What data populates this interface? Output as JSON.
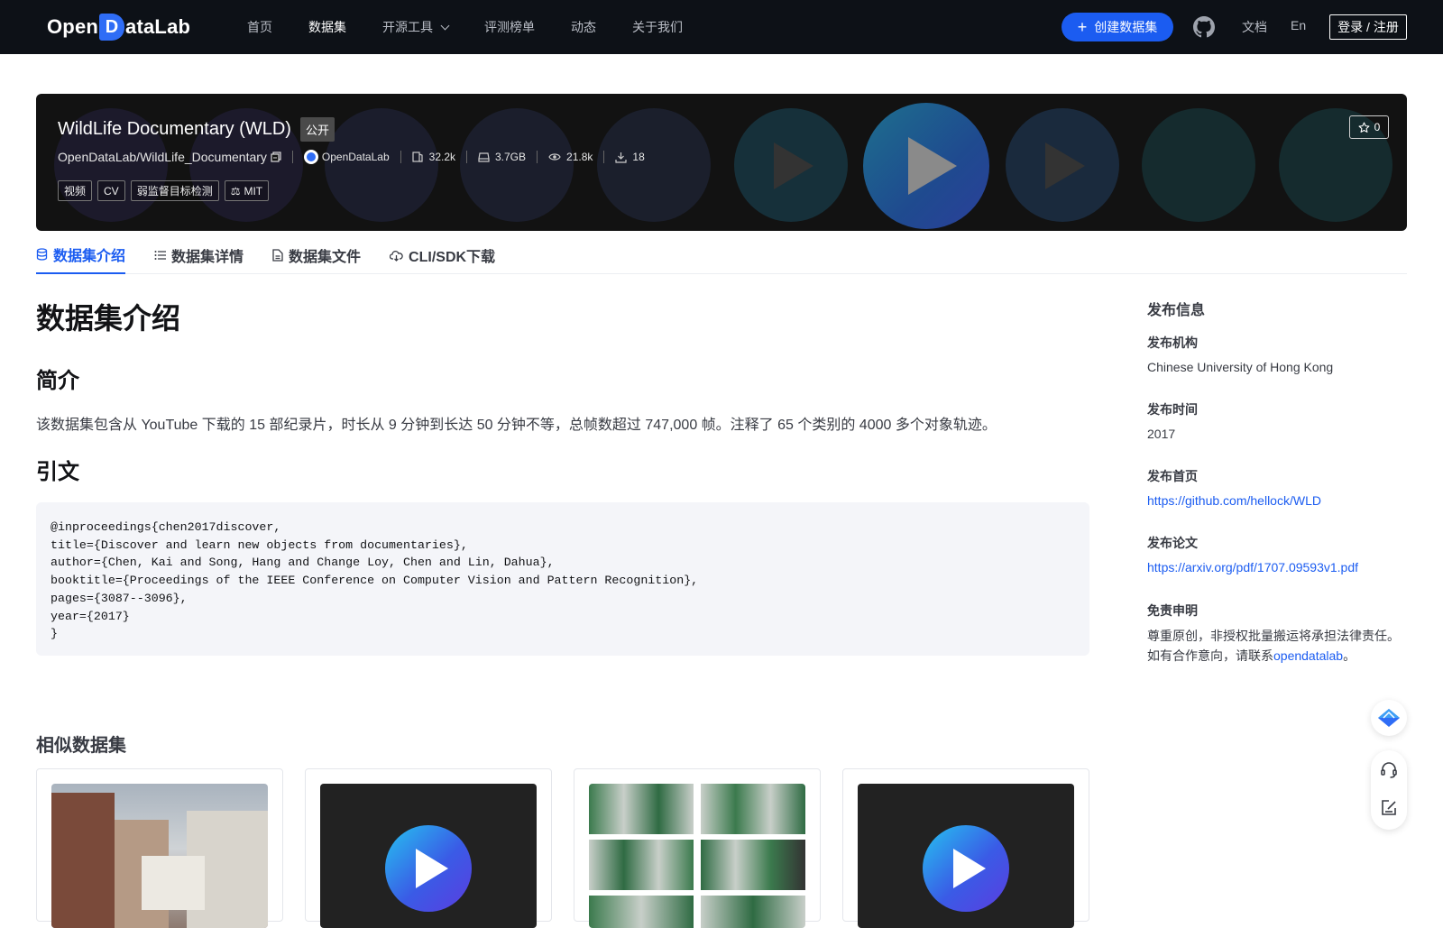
{
  "nav": {
    "logo_left": "Open",
    "logo_d": "D",
    "logo_right": "ataLab",
    "items": [
      {
        "label": "首页"
      },
      {
        "label": "数据集"
      },
      {
        "label": "开源工具"
      },
      {
        "label": "评测榜单"
      },
      {
        "label": "动态"
      },
      {
        "label": "关于我们"
      }
    ],
    "active_item": "数据集",
    "create_button": "创建数据集",
    "docs": "文档",
    "lang": "En",
    "login": "登录 / 注册"
  },
  "banner": {
    "title": "WildLife Documentary (WLD)",
    "visibility": "公开",
    "path": "OpenDataLab/WildLife_Documentary",
    "org": "OpenDataLab",
    "file_count": "32.2k",
    "size": "3.7GB",
    "views": "21.8k",
    "downloads": "18",
    "stars": "0",
    "tags": [
      "视频",
      "CV",
      "弱监督目标检测"
    ],
    "license": "MIT"
  },
  "tabs": [
    {
      "label": "数据集介绍",
      "icon": "database-icon"
    },
    {
      "label": "数据集详情",
      "icon": "list-icon"
    },
    {
      "label": "数据集文件",
      "icon": "file-icon"
    },
    {
      "label": "CLI/SDK下载",
      "icon": "cloud-download-icon"
    }
  ],
  "active_tab": "数据集介绍",
  "content": {
    "title": "数据集介绍",
    "intro_heading": "简介",
    "intro_text": "该数据集包含从 YouTube 下载的 15 部纪录片，时长从 9 分钟到长达 50 分钟不等，总帧数超过 747,000 帧。注释了 65 个类别的 4000 多个对象轨迹。",
    "citation_heading": "引文",
    "citation": "@inproceedings{chen2017discover,\ntitle={Discover and learn new objects from documentaries},\nauthor={Chen, Kai and Song, Hang and Change Loy, Chen and Lin, Dahua},\nbooktitle={Proceedings of the IEEE Conference on Computer Vision and Pattern Recognition},\npages={3087--3096},\nyear={2017}\n}"
  },
  "sidebar": {
    "title": "发布信息",
    "org_label": "发布机构",
    "org_value": "Chinese University of Hong Kong",
    "time_label": "发布时间",
    "time_value": "2017",
    "homepage_label": "发布首页",
    "homepage_value": "https://github.com/hellock/WLD",
    "paper_label": "发布论文",
    "paper_value": "https://arxiv.org/pdf/1707.09593v1.pdf",
    "disclaimer_label": "免责申明",
    "disclaimer_line1": "尊重原创，非授权批量搬运将承担法律责任。",
    "disclaimer_line2_prefix": "如有合作意向，请联系",
    "disclaimer_link": "opendatalab",
    "disclaimer_line2_suffix": "。"
  },
  "similar": {
    "title": "相似数据集",
    "cards": [
      {
        "thumb": "street-photo"
      },
      {
        "thumb": "video"
      },
      {
        "thumb": "image-grid"
      },
      {
        "thumb": "video"
      }
    ]
  },
  "colors": {
    "accent": "#1b5cf1",
    "nav_bg": "#0d1117",
    "banner_bg": "#121212"
  }
}
